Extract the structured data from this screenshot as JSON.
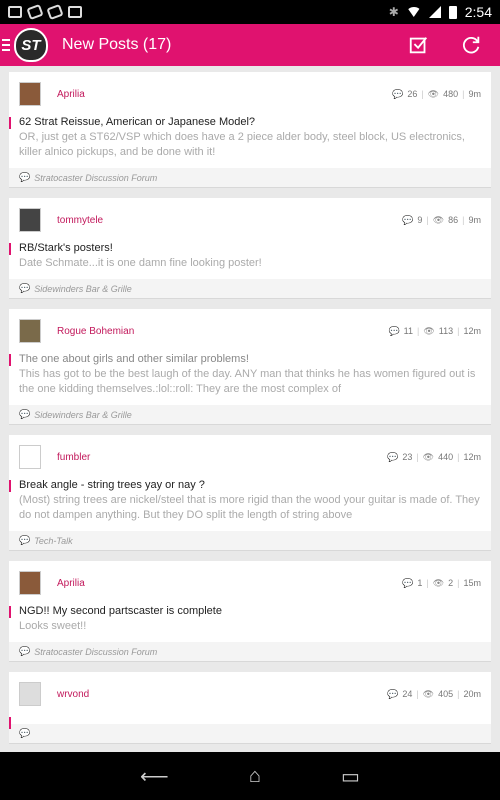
{
  "status": {
    "time": "2:54"
  },
  "appbar": {
    "title": "New Posts (17)",
    "logo_text": "ST"
  },
  "posts": [
    {
      "user": "Aprilia",
      "replies": "26",
      "views": "480",
      "age": "9m",
      "title": "62 Strat Reissue, American or Japanese Model?",
      "snippet": "OR, just get a ST62/VSP which does have a 2 piece alder body, steel block, US electronics, killer alnico pickups, and be done with it!",
      "forum": "Stratocaster Discussion Forum",
      "read": false
    },
    {
      "user": "tommytele",
      "replies": "9",
      "views": "86",
      "age": "9m",
      "title": "RB/Stark's posters!",
      "snippet": "Date Schmate...it is one damn fine looking poster!",
      "forum": "Sidewinders Bar & Grille",
      "read": false
    },
    {
      "user": "Rogue Bohemian",
      "replies": "11",
      "views": "113",
      "age": "12m",
      "title": "The one about girls and other similar problems!",
      "snippet": "This has got to be the best laugh of the day. ANY man that thinks he has women figured out is the one kidding themselves.:lol::roll: They are the most complex of",
      "forum": "Sidewinders Bar & Grille",
      "read": true
    },
    {
      "user": "fumbler",
      "replies": "23",
      "views": "440",
      "age": "12m",
      "title": "Break angle - string trees yay or nay ?",
      "snippet": "(Most) string trees are nickel/steel that is more rigid than the wood your guitar is made of. They do not dampen anything. But they DO split the length of string above",
      "forum": "Tech-Talk",
      "read": false
    },
    {
      "user": "Aprilia",
      "replies": "1",
      "views": "2",
      "age": "15m",
      "title": "NGD!! My second partscaster is complete",
      "snippet": "Looks sweet!!",
      "forum": "Stratocaster Discussion Forum",
      "read": false
    },
    {
      "user": "wrvond",
      "replies": "24",
      "views": "405",
      "age": "20m",
      "title": "",
      "snippet": "",
      "forum": "",
      "read": false
    }
  ]
}
